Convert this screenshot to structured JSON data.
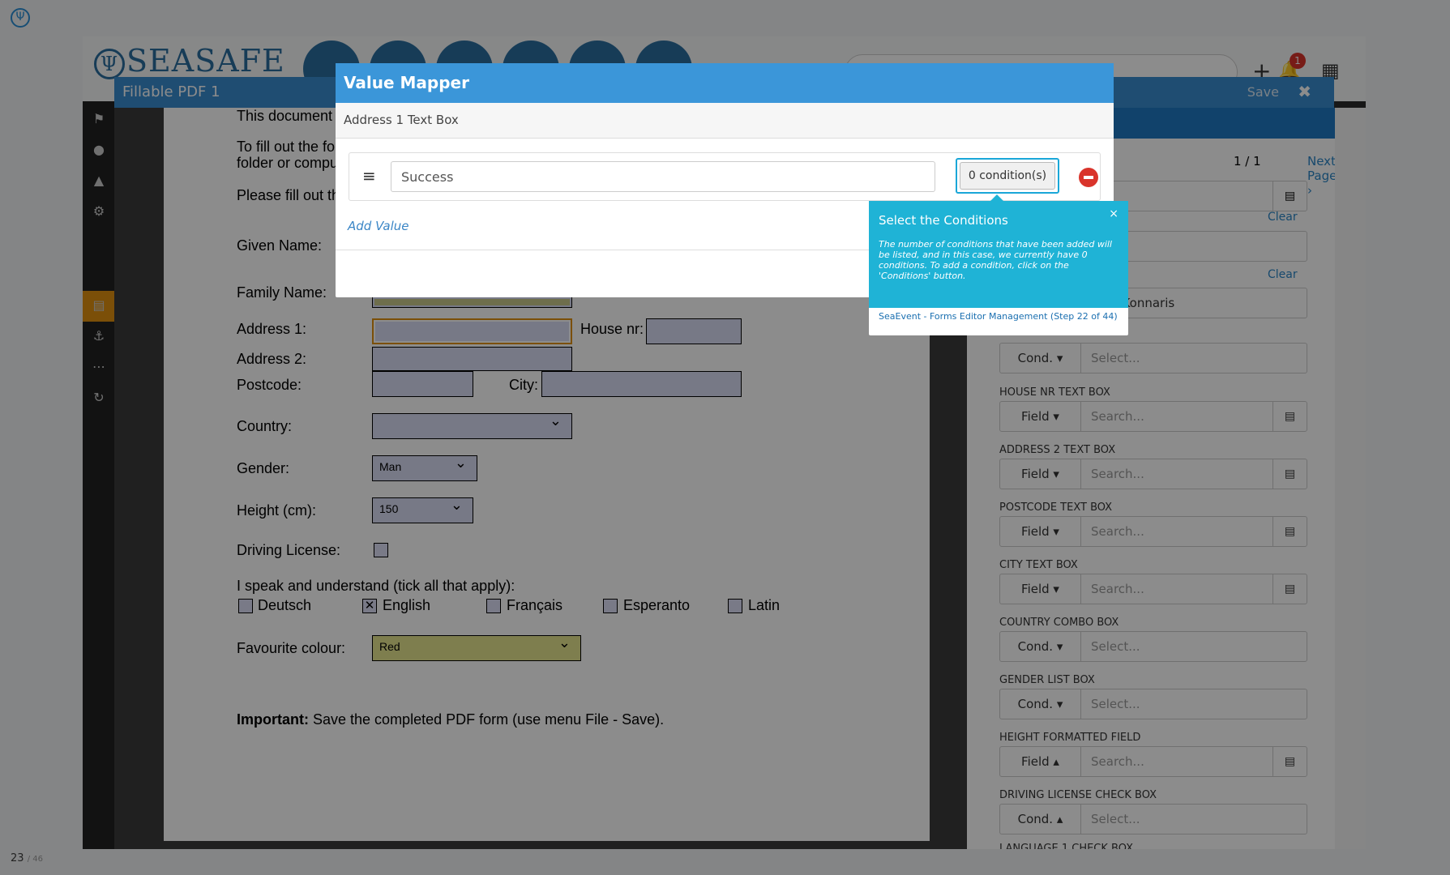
{
  "pdf": {
    "intro": "This document a",
    "fill_line1": "To fill out the for",
    "fill_line2": "folder or comput",
    "please": "Please fill out th",
    "labels": {
      "given_name": "Given Name:",
      "family_name": "Family Name:",
      "address1": "Address 1:",
      "house_nr": "House nr:",
      "address2": "Address 2:",
      "postcode": "Postcode:",
      "city": "City:",
      "country": "Country:",
      "gender": "Gender:",
      "height": "Height (cm):",
      "driving": "Driving License:",
      "speak": "I speak and understand (tick all that apply):",
      "colour": "Favourite colour:"
    },
    "gender_value": "Man",
    "height_value": "150",
    "colour_value": "Red",
    "languages": [
      {
        "label": "Deutsch",
        "checked": false
      },
      {
        "label": "English",
        "checked": true
      },
      {
        "label": "Français",
        "checked": false
      },
      {
        "label": "Esperanto",
        "checked": false
      },
      {
        "label": "Latin",
        "checked": false
      }
    ],
    "important_bold": "Important:",
    "important_text": " Save the completed PDF form (use menu File - Save)."
  },
  "app": {
    "brand": "SEASAFE",
    "notif_count": "1",
    "window_title": "Fillable PDF 1",
    "save": "Save"
  },
  "right_panel": {
    "pager": "1 / 1",
    "next_page": "Next Page ›",
    "clear": "Clear",
    "name_fragment": "s Konnaris",
    "fields": [
      {
        "label": "",
        "type": "Cond. ▾",
        "placeholder": "Select...",
        "btn": false
      },
      {
        "label": "HOUSE NR TEXT BOX",
        "type": "Field ▾",
        "placeholder": "Search...",
        "btn": true
      },
      {
        "label": "ADDRESS 2 TEXT BOX",
        "type": "Field ▾",
        "placeholder": "Search...",
        "btn": true
      },
      {
        "label": "POSTCODE TEXT BOX",
        "type": "Field ▾",
        "placeholder": "Search...",
        "btn": true
      },
      {
        "label": "CITY TEXT BOX",
        "type": "Field ▾",
        "placeholder": "Search...",
        "btn": true
      },
      {
        "label": "COUNTRY COMBO BOX",
        "type": "Cond. ▾",
        "placeholder": "Select...",
        "btn": false
      },
      {
        "label": "GENDER LIST BOX",
        "type": "Cond. ▾",
        "placeholder": "Select...",
        "btn": false
      },
      {
        "label": "HEIGHT FORMATTED FIELD",
        "type": "Field ▴",
        "placeholder": "Search...",
        "btn": true
      },
      {
        "label": "DRIVING LICENSE CHECK BOX",
        "type": "Cond. ▴",
        "placeholder": "Select...",
        "btn": false
      },
      {
        "label": "LANGUAGE 1 CHECK BOX",
        "type": "",
        "placeholder": "",
        "btn": false
      }
    ]
  },
  "modal": {
    "title": "Value Mapper",
    "subtitle": "Address 1 Text Box",
    "value": "Success",
    "conditions_label": "0 condition(s)",
    "add_value": "Add Value"
  },
  "tooltip": {
    "title": "Select the Conditions",
    "text": "The number of conditions that have been added will be listed, and in this case, we currently have 0 conditions. To add a condition, click on the 'Conditions' button.",
    "footer": "SeaEvent - Forms Editor Management (Step 22 of 44)",
    "close": "×"
  },
  "counter": {
    "current": "23",
    "total": "/ 46"
  }
}
